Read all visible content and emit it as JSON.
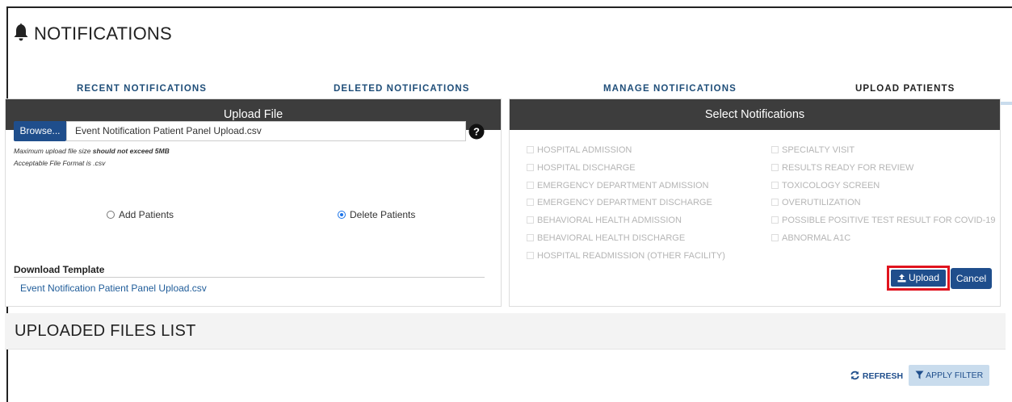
{
  "header": {
    "title": "NOTIFICATIONS",
    "icon": "bell-icon"
  },
  "tabs": [
    {
      "label": "RECENT NOTIFICATIONS",
      "active": false
    },
    {
      "label": "DELETED NOTIFICATIONS",
      "active": false
    },
    {
      "label": "MANAGE NOTIFICATIONS",
      "active": false
    },
    {
      "label": "UPLOAD PATIENTS",
      "active": true
    }
  ],
  "upload_file": {
    "heading": "Upload File",
    "browse_label": "Browse...",
    "file_value": "Event Notification Patient Panel Upload.csv",
    "note_size_prefix": "Maximum upload file size ",
    "note_size_strong": "should not exceed 5MB",
    "note_format": "Acceptable File Format is .csv",
    "radio_add": "Add Patients",
    "radio_delete": "Delete Patients",
    "selected_radio": "Delete Patients",
    "download_title": "Download Template",
    "download_link": "Event Notification Patient Panel Upload.csv"
  },
  "select_notifications": {
    "heading": "Select Notifications",
    "left": [
      "HOSPITAL ADMISSION",
      "HOSPITAL DISCHARGE",
      "EMERGENCY DEPARTMENT ADMISSION",
      "EMERGENCY DEPARTMENT DISCHARGE",
      "BEHAVIORAL HEALTH ADMISSION",
      "BEHAVIORAL HEALTH DISCHARGE",
      "HOSPITAL READMISSION (OTHER FACILITY)"
    ],
    "right": [
      "SPECIALTY VISIT",
      "RESULTS READY FOR REVIEW",
      "TOXICOLOGY SCREEN",
      "OVERUTILIZATION",
      "POSSIBLE POSITIVE TEST RESULT FOR COVID-19",
      "ABNORMAL A1C"
    ],
    "upload_label": "Upload",
    "cancel_label": "Cancel"
  },
  "uploaded_files": {
    "title": "UPLOADED FILES LIST",
    "refresh_label": "REFRESH",
    "filter_label": "APPLY FILTER"
  },
  "colors": {
    "accent": "#1f4e8c",
    "panel_header": "#3d3d3d",
    "highlight": "#e0141e",
    "tab_text": "#1f4e79"
  }
}
